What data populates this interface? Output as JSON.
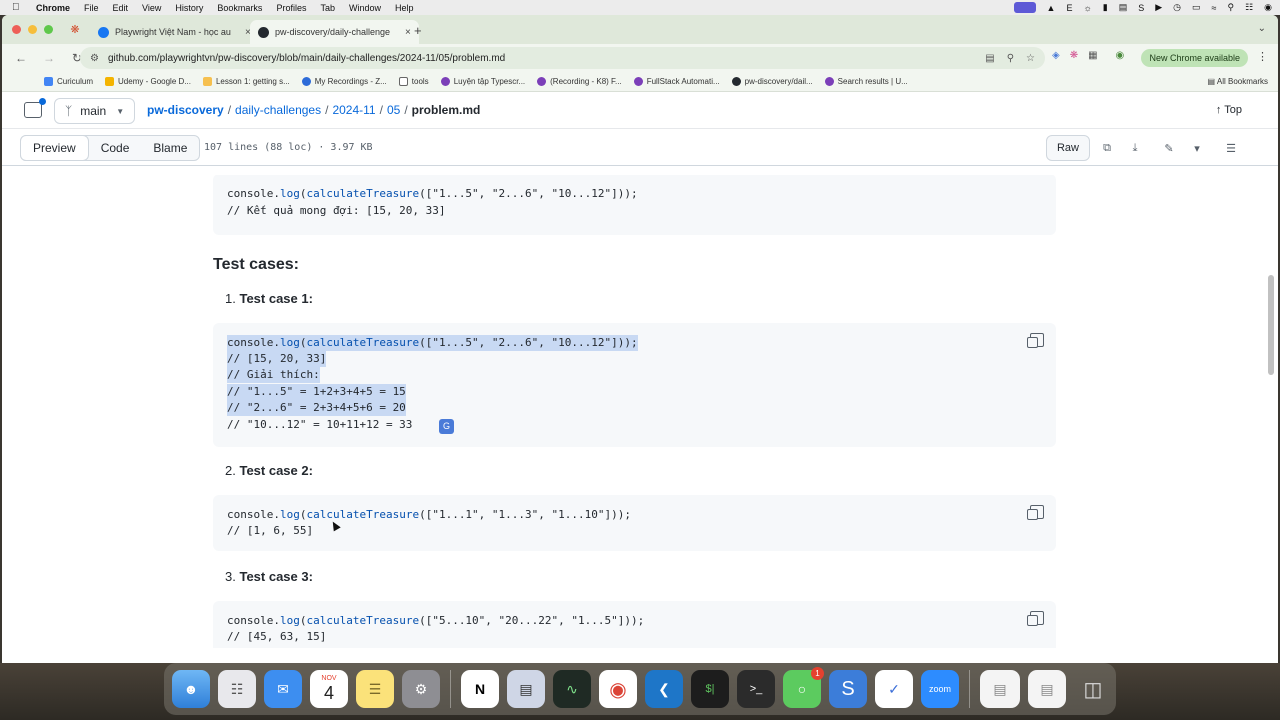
{
  "menubar": {
    "app": "Chrome",
    "items": [
      "File",
      "Edit",
      "View",
      "History",
      "Bookmarks",
      "Profiles",
      "Tab",
      "Window",
      "Help"
    ],
    "status_letter": "E"
  },
  "tabs": [
    {
      "title": "Playwright Việt Nam - học au",
      "favicon_color": "#1877f2"
    },
    {
      "title": "pw-discovery/daily-challenge",
      "favicon_color": "#24292f"
    }
  ],
  "address": {
    "url": "github.com/playwrightvn/pw-discovery/blob/main/daily-challenges/2024-11/05/problem.md",
    "new_chrome": "New Chrome available"
  },
  "bookmarks": {
    "items": [
      {
        "label": "Curiculum",
        "color": "#4285f4"
      },
      {
        "label": "Udemy - Google D...",
        "color": "#f4b400"
      },
      {
        "label": "Lesson 1: getting s...",
        "color": "#f6c04f"
      },
      {
        "label": "My Recordings - Z...",
        "color": "#2d6bd8"
      },
      {
        "label": "tools",
        "color": "#888888"
      },
      {
        "label": "Luyện tập Typescr...",
        "color": "#7b3fb8"
      },
      {
        "label": "(Recording - K8) F...",
        "color": "#7b3fb8"
      },
      {
        "label": "FullStack Automati...",
        "color": "#7b3fb8"
      },
      {
        "label": "pw-discovery/dail...",
        "color": "#24292f"
      },
      {
        "label": "Search results | U...",
        "color": "#7b3fb8"
      }
    ],
    "all": "All Bookmarks"
  },
  "repo": {
    "branch": "main",
    "crumbs": [
      "pw-discovery",
      "daily-challenges",
      "2024-11",
      "05"
    ],
    "file": "problem.md",
    "top": "Top",
    "views": [
      "Preview",
      "Code",
      "Blame"
    ],
    "file_info": "107 lines (88 loc) · 3.97 KB",
    "raw": "Raw"
  },
  "content": {
    "intro_code": [
      "console.log(calculateTreasure([\"1...5\", \"2...6\", \"10...12\"]));",
      "// Kết quả mong đợi: [15, 20, 33]"
    ],
    "heading": "Test cases:",
    "cases": [
      {
        "num": "1.",
        "title": "Test case 1:",
        "lines": [
          "console.log(calculateTreasure([\"1...5\", \"2...6\", \"10...12\"]));",
          "// [15, 20, 33]",
          "// Giải thích:",
          "// \"1...5\" = 1+2+3+4+5 = 15",
          "// \"2...6\" = 2+3+4+5+6 = 20",
          "// \"10...12\" = 10+11+12 = 33"
        ]
      },
      {
        "num": "2.",
        "title": "Test case 2:",
        "lines": [
          "console.log(calculateTreasure([\"1...1\", \"1...3\", \"1...10\"]));",
          "// [1, 6, 55]"
        ]
      },
      {
        "num": "3.",
        "title": "Test case 3:",
        "lines": [
          "console.log(calculateTreasure([\"5...10\", \"20...22\", \"1...5\"]));",
          "// [45, 63, 15]"
        ]
      }
    ]
  },
  "dock": {
    "calendar_month": "NOV",
    "calendar_day": "4",
    "messages_badge": "1",
    "zoom_label": "zoom"
  }
}
